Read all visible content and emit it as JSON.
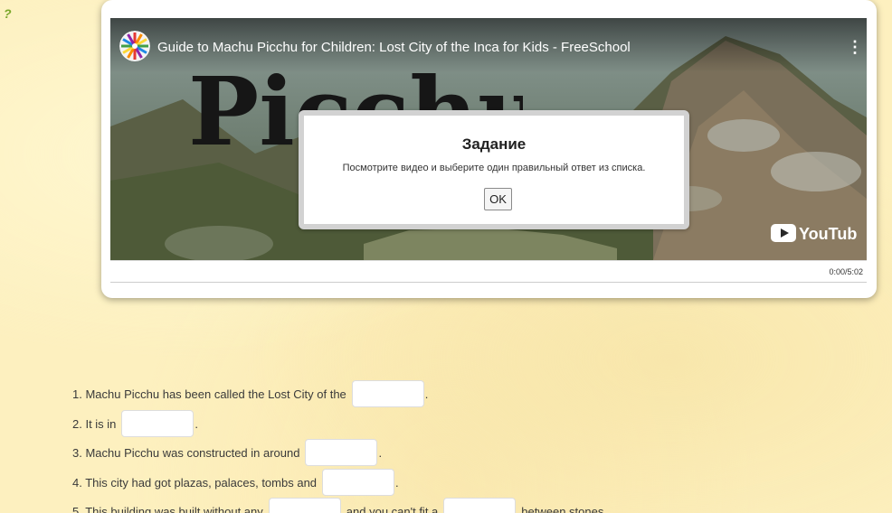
{
  "help_icon": "?",
  "video": {
    "title": "Guide to Machu Picchu for Children: Lost City of the Inca for Kids - FreeSchool",
    "overlay_word": "Picchu",
    "youtube_brand": "YouTube",
    "time": "0:00/5:02",
    "more_icon": "more-vertical-icon"
  },
  "modal": {
    "title": "Задание",
    "message": "Посмотрите видео и выберите один правильный ответ из списка.",
    "ok_label": "OK"
  },
  "questions": [
    {
      "before": "1. Machu Picchu has been called the Lost City of the",
      "after": "."
    },
    {
      "before": "2. It is in",
      "after": "."
    },
    {
      "before": "3. Machu Picchu was constructed in around",
      "after": "."
    },
    {
      "before": "4. This city had got plazas, palaces, tombs and",
      "after": "."
    },
    {
      "before": "5. This building was built without any",
      "middle": "and you can't fit a",
      "after": "between stones."
    }
  ]
}
